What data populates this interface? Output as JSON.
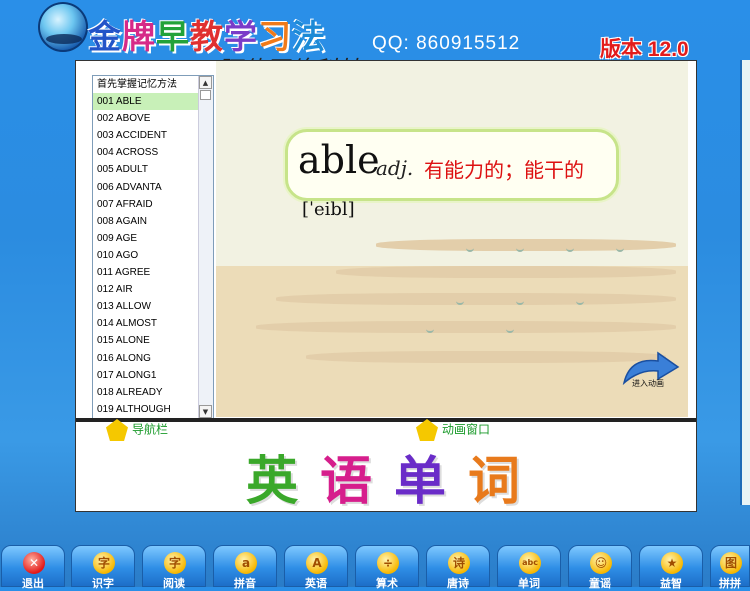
{
  "header": {
    "title_chars": [
      "金",
      "牌",
      "早",
      "教",
      "学",
      "习",
      "法"
    ],
    "qq": "QQ:  860915512",
    "version": "版本 12.0",
    "watermark": "阿伟网络科技"
  },
  "word_list": {
    "header": "首先掌握记忆方法",
    "items": [
      "001 ABLE",
      "002 ABOVE",
      "003 ACCIDENT",
      "004 ACROSS",
      "005 ADULT",
      "006 ADVANTA",
      "007 AFRAID",
      "008 AGAIN",
      "009 AGE",
      "010 AGO",
      "011 AGREE",
      "012 AIR",
      "013 ALLOW",
      "014 ALMOST",
      "015 ALONE",
      "016 ALONG",
      "017 ALONG1",
      "018 ALREADY",
      "019 ALTHOUGH"
    ],
    "selected_index": 0
  },
  "word_card": {
    "word": "able",
    "pos": "adj.",
    "meaning": "有能力的；能干的",
    "phonetic": "[ˈeibl]"
  },
  "scene": {
    "enter_animation_label": "进入动画"
  },
  "bottom_panel": {
    "nav_toggle": "导航栏",
    "anim_toggle": "动画窗口",
    "big_title_chars": [
      "英",
      "语",
      "单",
      "词"
    ]
  },
  "toolbar": {
    "buttons": [
      {
        "label": "退出",
        "icon": "✕",
        "icon_name": "exit-icon"
      },
      {
        "label": "识字",
        "icon": "字",
        "icon_name": "literacy-icon"
      },
      {
        "label": "阅读",
        "icon": "字",
        "icon_name": "reading-icon"
      },
      {
        "label": "拼音",
        "icon": "a",
        "icon_name": "pinyin-icon"
      },
      {
        "label": "英语",
        "icon": "A",
        "icon_name": "english-icon"
      },
      {
        "label": "算术",
        "icon": "÷",
        "icon_name": "math-icon"
      },
      {
        "label": "唐诗",
        "icon": "诗",
        "icon_name": "poetry-icon"
      },
      {
        "label": "单词",
        "icon": "abc",
        "icon_name": "words-icon"
      },
      {
        "label": "童谣",
        "icon": "☺",
        "icon_name": "nursery-rhyme-icon"
      },
      {
        "label": "益智",
        "icon": "★",
        "icon_name": "puzzle-icon"
      },
      {
        "label": "拼拼",
        "icon": "图",
        "icon_name": "jigsaw-icon"
      }
    ]
  },
  "colors": {
    "background": "#2a8fe8",
    "selected_row": "#c8f0b8",
    "meaning_red": "#d11111",
    "version_red": "#e21c1c"
  }
}
